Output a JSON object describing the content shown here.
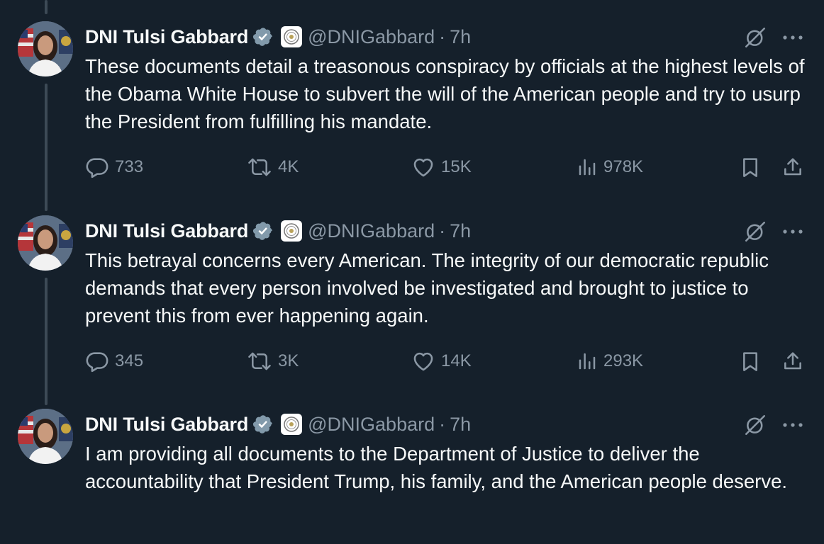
{
  "colors": {
    "background": "#15202b",
    "text_primary": "#f7f9f9",
    "text_secondary": "#8b98a5",
    "verified_badge": "#829aab",
    "thread_line": "#3d4a56"
  },
  "tweets": [
    {
      "author_name": "DNI Tulsi Gabbard",
      "handle": "@DNIGabbard",
      "separator": "·",
      "time": "7h",
      "text": "These documents detail a treasonous conspiracy by officials at the highest levels of the Obama White House to subvert the will of the American people and try to usurp the President from fulfilling his mandate.",
      "replies": "733",
      "reposts": "4K",
      "likes": "15K",
      "views": "978K"
    },
    {
      "author_name": "DNI Tulsi Gabbard",
      "handle": "@DNIGabbard",
      "separator": "·",
      "time": "7h",
      "text": "This betrayal concerns every American. The integrity of our democratic republic demands that every person involved be investigated and brought to justice to prevent this from ever happening again.",
      "replies": "345",
      "reposts": "3K",
      "likes": "14K",
      "views": "293K"
    },
    {
      "author_name": "DNI Tulsi Gabbard",
      "handle": "@DNIGabbard",
      "separator": "·",
      "time": "7h",
      "text": "I am providing all documents to the Department of Justice to deliver the accountability that President Trump, his family, and the American people deserve."
    }
  ],
  "icons": {
    "verified": "verified-badge-icon",
    "affiliation": "dni-seal-icon",
    "grok": "grok-icon",
    "more": "more-icon",
    "reply": "reply-icon",
    "repost": "repost-icon",
    "like": "heart-icon",
    "views": "views-icon",
    "bookmark": "bookmark-icon",
    "share": "share-icon"
  }
}
